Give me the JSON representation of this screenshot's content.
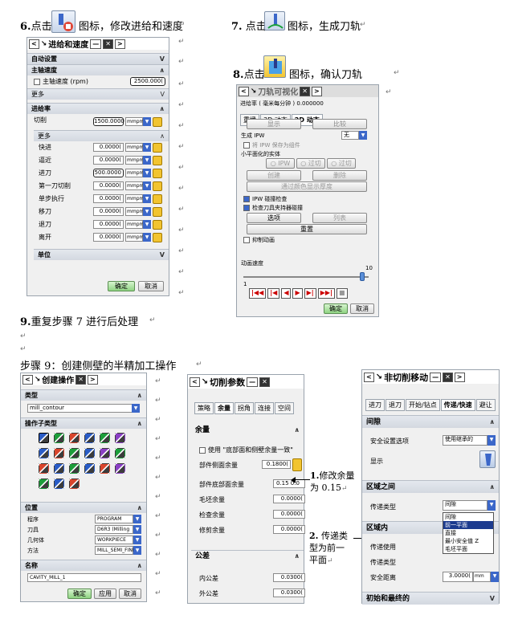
{
  "step6": {
    "num": "6.",
    "text_before": "点击",
    "text_after": "图标，修改进给和速度"
  },
  "step7": {
    "num": "7.",
    "text_before": "点击",
    "text_after": "图标，生成刀轨"
  },
  "step8": {
    "num": "8.",
    "text_before": "点击",
    "text_after": "图标，确认刀轨"
  },
  "step9": {
    "num": "9.",
    "text": "重复步骤 7 进行后处理"
  },
  "step9b": {
    "text": "步骤 9：创建侧壁的半精加工操作"
  },
  "return_mark": "↵",
  "feeds_dialog": {
    "title": "进给和速度",
    "auto_settings": "自动设置",
    "spindle_speed": "主轴速度",
    "spindle_speed_check": "主轴速度 (rpm)",
    "spindle_speed_value": "2500.000(",
    "more": "更多",
    "feed_rate": "进给率",
    "cut": "切削",
    "cut_value": "1500.0000",
    "unit": "mmpm",
    "more2": "更多",
    "rows": [
      {
        "label": "快进",
        "value": "0.0000("
      },
      {
        "label": "逼近",
        "value": "0.0000("
      },
      {
        "label": "进刀",
        "value": "500.0000"
      },
      {
        "label": "第一刀切削",
        "value": "0.0000("
      },
      {
        "label": "单步执行",
        "value": "0.0000("
      },
      {
        "label": "移刀",
        "value": "0.0000("
      },
      {
        "label": "退刀",
        "value": "0.0000("
      },
      {
        "label": "离开",
        "value": "0.0000("
      }
    ],
    "units": "单位",
    "ok": "确定",
    "cancel": "取消"
  },
  "visualize_dialog": {
    "title": "刀轨可视化",
    "feed_rate_label": "进给率 ( 毫米每分钟 )",
    "feed_rate_value": "0.000000",
    "tabs": [
      "重播",
      "3D 动态",
      "2D 动态"
    ],
    "display": "显示",
    "compare": "比较",
    "generate_ipw": "生成 IPW",
    "ipw_value": "无",
    "save_ipw": "将 IPW 保存为组件",
    "small_facet": "小平面化的实体",
    "radio_ipw": "IPW",
    "radio_cut": "过切",
    "radio_compare": "过切",
    "create": "创建",
    "delete": "删除",
    "through_color": "通过颜色显示厚度",
    "check_ipw": "IPW 碰撞检查",
    "check_tool": "检查刀具夹持器碰撞",
    "options": "选项",
    "list": "列表",
    "reset": "重置",
    "suppress": "抑制动画",
    "anim_speed": "动画速度",
    "speed_min": "1",
    "speed_max": "10",
    "speed_level": 0.95,
    "ok": "确定",
    "cancel": "取消"
  },
  "create_op_dialog": {
    "title": "创建操作",
    "type_section": "类型",
    "type_value": "mill_contour",
    "subtype_section": "操作子类型",
    "location_section": "位置",
    "program_label": "程序",
    "program_value": "PROGRAM",
    "tool_label": "刀具",
    "tool_value": "D6R3 (Milling",
    "geom_label": "几何体",
    "geom_value": "WORKPIECE",
    "method_label": "方法",
    "method_value": "MILL_SEMI_FINI",
    "name_section": "名称",
    "name_value": "CAVITY_MILL_1",
    "ok": "确定",
    "apply": "应用",
    "cancel": "取消"
  },
  "cut_params_dialog": {
    "title": "切削参数",
    "tabs": [
      "策略",
      "余量",
      "拐角",
      "连接",
      "空间"
    ],
    "stock_section": "余量",
    "use_same": "使用 \"底部面和侧壁余量一致\"",
    "side_stock": "部件侧面余量",
    "side_stock_value": "0.1800(",
    "floor_stock": "部件底部面余量",
    "floor_stock_value": "0.15 0.0",
    "blank_stock": "毛坯余量",
    "blank_stock_value": "0.0000(",
    "check_stock": "检查余量",
    "check_stock_value": "0.0000(",
    "trim_stock": "修剪余量",
    "trim_stock_value": "0.0000(",
    "tolerance_section": "公差",
    "intol": "内公差",
    "intol_value": "0.0300(",
    "outtol": "外公差",
    "outtol_value": "0.0300("
  },
  "note1": {
    "num": "1.",
    "text1": "修改余量",
    "text2": "为 0.15"
  },
  "note2": {
    "num": "2.",
    "text1": "传递类",
    "text2": "型为前一",
    "text3": "平面"
  },
  "noncut_dialog": {
    "title": "非切削移动",
    "tabs": [
      "进刀",
      "退刀",
      "开始/钻点",
      "传递/快速",
      "避让"
    ],
    "clearance_section": "间隙",
    "safe_option": "安全设置选项",
    "safe_value": "使用继承的",
    "display": "显示",
    "between_section": "区域之间",
    "transfer_type": "传递类型",
    "transfer_value": "间隙",
    "dropdown_items": [
      "间隙",
      "前一平面",
      "直接",
      "最小安全值 Z",
      "毛坯平面"
    ],
    "within_section": "区域内",
    "transfer_use": "传递使用",
    "transfer_type2": "传递类型",
    "safe_distance": "安全距离",
    "safe_distance_value": "3.0000(",
    "unit": "mm",
    "initial_final": "初始和最终的"
  }
}
